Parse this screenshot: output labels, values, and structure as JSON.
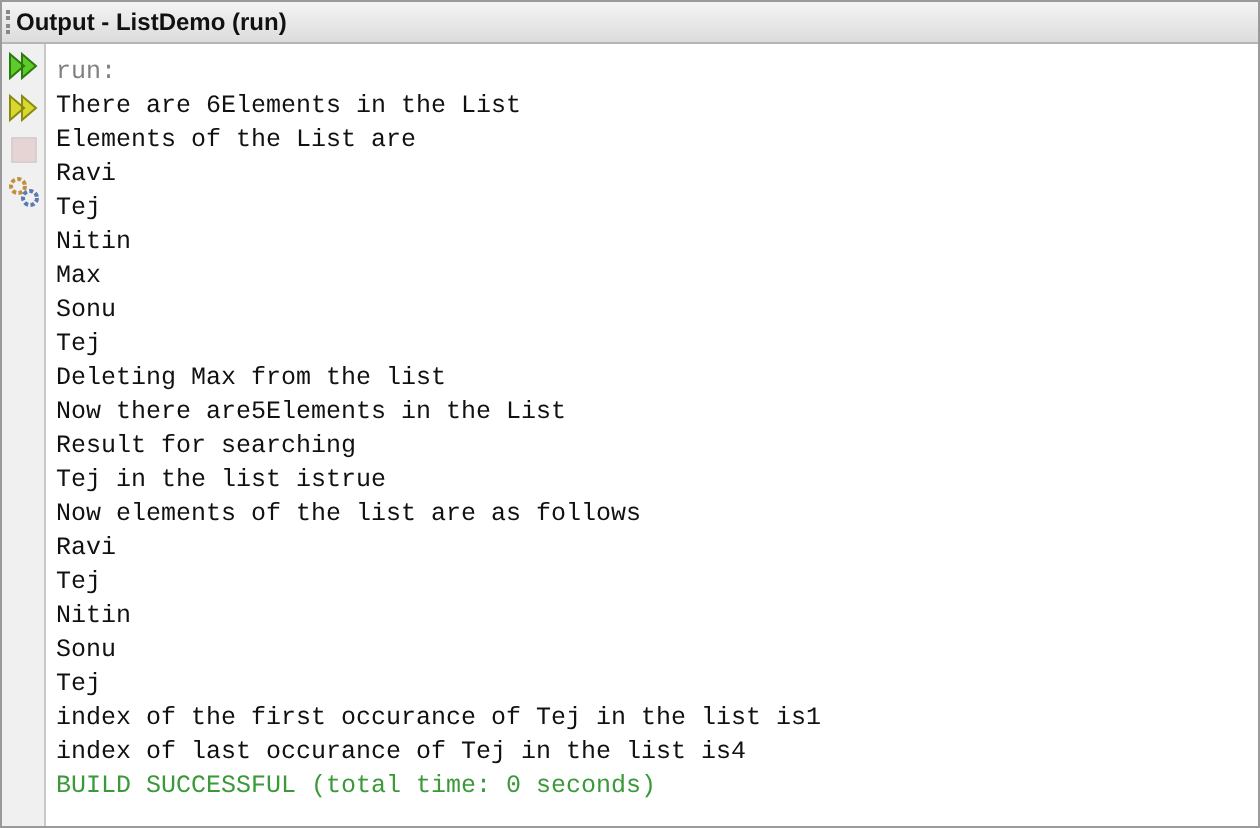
{
  "window": {
    "title": "Output - ListDemo (run)"
  },
  "toolbar": [
    {
      "kind": "rerun",
      "disabled": false
    },
    {
      "kind": "rerun-params",
      "disabled": false
    },
    {
      "kind": "stop",
      "disabled": true
    },
    {
      "kind": "settings",
      "disabled": false
    }
  ],
  "output_lines": [
    {
      "kind": "info",
      "text": "run:"
    },
    {
      "kind": "out",
      "text": "There are 6Elements in the List"
    },
    {
      "kind": "out",
      "text": "Elements of the List are"
    },
    {
      "kind": "out",
      "text": "Ravi"
    },
    {
      "kind": "out",
      "text": "Tej"
    },
    {
      "kind": "out",
      "text": "Nitin"
    },
    {
      "kind": "out",
      "text": "Max"
    },
    {
      "kind": "out",
      "text": "Sonu"
    },
    {
      "kind": "out",
      "text": "Tej"
    },
    {
      "kind": "out",
      "text": "Deleting Max from the list"
    },
    {
      "kind": "out",
      "text": "Now there are5Elements in the List"
    },
    {
      "kind": "out",
      "text": "Result for searching"
    },
    {
      "kind": "out",
      "text": "Tej in the list istrue"
    },
    {
      "kind": "out",
      "text": "Now elements of the list are as follows"
    },
    {
      "kind": "out",
      "text": "Ravi"
    },
    {
      "kind": "out",
      "text": "Tej"
    },
    {
      "kind": "out",
      "text": "Nitin"
    },
    {
      "kind": "out",
      "text": "Sonu"
    },
    {
      "kind": "out",
      "text": "Tej"
    },
    {
      "kind": "out",
      "text": "index of the first occurance of Tej in the list is1"
    },
    {
      "kind": "out",
      "text": "index of last occurance of Tej in the list is4"
    },
    {
      "kind": "success",
      "text": "BUILD SUCCESSFUL (total time: 0 seconds)"
    }
  ]
}
